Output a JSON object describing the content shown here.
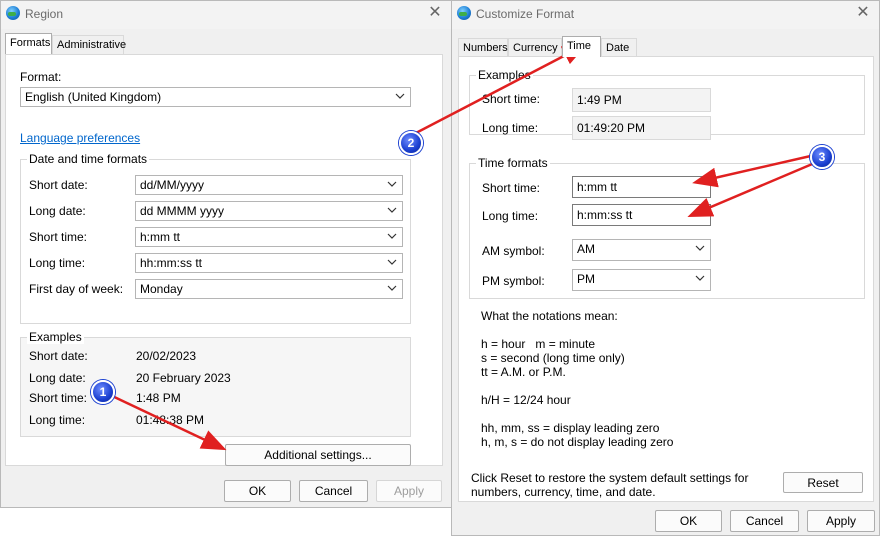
{
  "region": {
    "title": "Region",
    "tabs": [
      "Formats",
      "Administrative"
    ],
    "format_label": "Format:",
    "format_value": "English (United Kingdom)",
    "language_link": "Language preferences",
    "dt_group_title": "Date and time formats",
    "fields": [
      {
        "label": "Short date:",
        "value": "dd/MM/yyyy"
      },
      {
        "label": "Long date:",
        "value": "dd MMMM yyyy"
      },
      {
        "label": "Short time:",
        "value": "h:mm tt"
      },
      {
        "label": "Long time:",
        "value": "hh:mm:ss tt"
      },
      {
        "label": "First day of week:",
        "value": "Monday"
      }
    ],
    "examples_title": "Examples",
    "examples": [
      {
        "label": "Short date:",
        "value": "20/02/2023"
      },
      {
        "label": "Long date:",
        "value": "20 February 2023"
      },
      {
        "label": "Short time:",
        "value": "1:48 PM"
      },
      {
        "label": "Long time:",
        "value": "01:48:38 PM"
      }
    ],
    "additional_settings": "Additional settings...",
    "ok": "OK",
    "cancel": "Cancel",
    "apply": "Apply"
  },
  "customize": {
    "title": "Customize Format",
    "tabs": [
      "Numbers",
      "Currency",
      "Time",
      "Date"
    ],
    "examples_title": "Examples",
    "examples": [
      {
        "label": "Short time:",
        "value": "1:49 PM"
      },
      {
        "label": "Long time:",
        "value": "01:49:20 PM"
      }
    ],
    "formats_title": "Time formats",
    "short_time_label": "Short time:",
    "short_time_value": "h:mm tt",
    "long_time_label": "Long time:",
    "long_time_value": "h:mm:ss tt",
    "am_label": "AM symbol:",
    "am_value": "AM",
    "pm_label": "PM symbol:",
    "pm_value": "PM",
    "notations_title": "What the notations mean:",
    "notes": [
      "h = hour   m = minute",
      "s = second (long time only)",
      "tt = A.M. or P.M.",
      "h/H = 12/24 hour",
      "hh, mm, ss = display leading zero",
      "h, m, s = do not display leading zero"
    ],
    "reset_text_1": "Click Reset to restore the system default settings for",
    "reset_text_2": "numbers, currency, time, and date.",
    "reset": "Reset",
    "ok": "OK",
    "cancel": "Cancel",
    "apply": "Apply"
  },
  "annotations": [
    "1",
    "2",
    "3"
  ],
  "colors": {
    "arrow": "#e02020",
    "badge": "#1a3fd0",
    "link": "#0066cc"
  }
}
